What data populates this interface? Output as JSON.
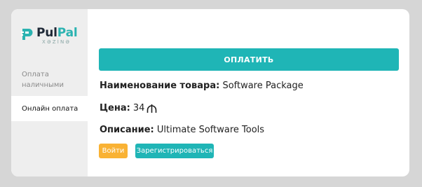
{
  "brand": {
    "name_dark": "Pul",
    "name_accent": "Pal",
    "subtitle": "XƏZİNƏ",
    "accent_color": "#2bb3b1"
  },
  "sidebar": {
    "items": [
      {
        "label_line1": "Оплата",
        "label_line2": "наличными",
        "active": false
      },
      {
        "label": "Онлайн оплата",
        "active": true
      }
    ]
  },
  "main": {
    "pay_button_label": "ОПЛАТИТЬ",
    "product": {
      "name_label": "Наименование товара:",
      "name_value": "Software Package",
      "price_label": "Цена:",
      "price_value": "34",
      "currency_icon": "manat-icon",
      "description_label": "Описание:",
      "description_value": "Ultimate Software Tools"
    },
    "login_button_label": "Войти",
    "register_button_label": "Зарегистрироваться"
  },
  "colors": {
    "primary": "#1fb5b6",
    "warning": "#f9b234",
    "sidebar_bg": "#eeeeee",
    "page_bg": "#d6d6d6"
  }
}
